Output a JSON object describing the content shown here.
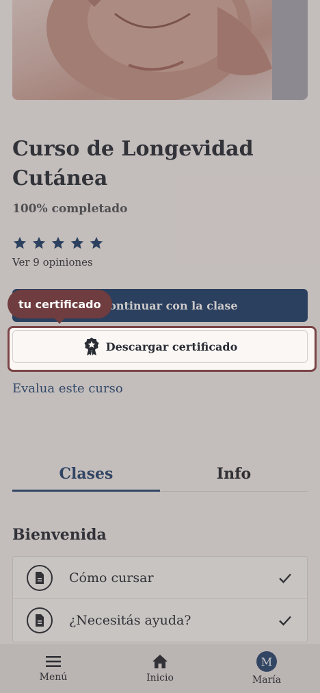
{
  "course": {
    "title": "Curso de Longevidad Cutánea",
    "progress": "100% completado",
    "rating": 5,
    "reviews_link": "Ver 9 opiniones"
  },
  "actions": {
    "continue_label": "Continuar con la clase",
    "download_certificate_label": "Descargar certificado",
    "rate_course_label": "Evalua este curso"
  },
  "tooltip": {
    "text": "tu certificado"
  },
  "tabs": [
    {
      "label": "Clases",
      "active": true
    },
    {
      "label": "Info",
      "active": false
    }
  ],
  "section": {
    "title": "Bienvenida",
    "lessons": [
      {
        "label": "Cómo cursar",
        "completed": true,
        "icon": "document-icon"
      },
      {
        "label": "¿Necesitás ayuda?",
        "completed": true,
        "icon": "document-icon"
      }
    ]
  },
  "bottom_nav": {
    "menu_label": "Menú",
    "home_label": "Inicio",
    "profile_label": "María",
    "profile_initial": "M"
  },
  "colors": {
    "primary": "#22416b",
    "accent_tooltip": "#6f3d3f",
    "link": "#2d4e79"
  }
}
